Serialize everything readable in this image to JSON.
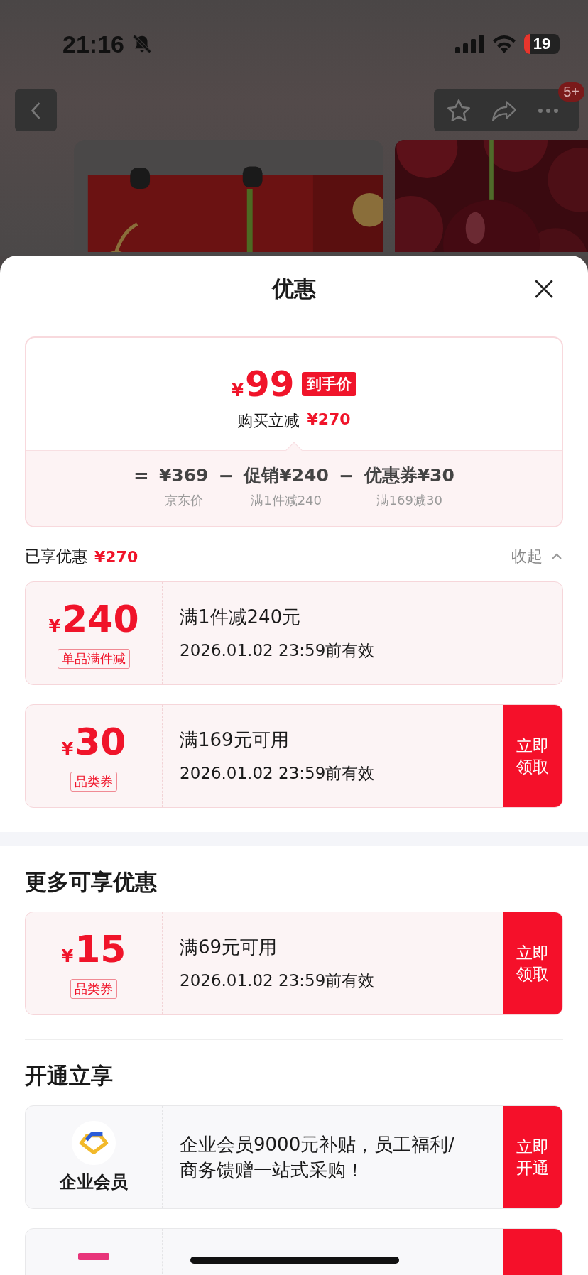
{
  "status_bar": {
    "time": "21:16",
    "battery": "19"
  },
  "nav": {
    "badge": "5+"
  },
  "sheet": {
    "title": "优惠",
    "summary": {
      "currency": "¥",
      "price": "99",
      "tag": "到手价",
      "saving_label": "购买立减",
      "saving": "¥270",
      "terms": [
        {
          "op": "=",
          "text": "¥369",
          "label": "京东价"
        },
        {
          "op": "−",
          "text": "促销¥240",
          "label": "满1件减240"
        },
        {
          "op": "−",
          "text": "优惠券¥30",
          "label": "满169减30"
        }
      ]
    },
    "enjoyed": {
      "label": "已享优惠",
      "amount": "¥270",
      "toggle": "收起",
      "expanded": true
    },
    "coupons": [
      {
        "kind": "promo",
        "currency": "¥",
        "amount": "240",
        "tag": "单品满件减",
        "title": "满1件减240元",
        "validity": "2026.01.02 23:59前有效"
      },
      {
        "kind": "coupon",
        "currency": "¥",
        "amount": "30",
        "tag": "品类券",
        "title": "满169元可用",
        "validity": "2026.01.02 23:59前有效",
        "button": "立即领取"
      }
    ],
    "more_title": "更多可享优惠",
    "more": [
      {
        "kind": "coupon",
        "currency": "¥",
        "amount": "15",
        "tag": "品类券",
        "title": "满69元可用",
        "validity": "2026.01.02 23:59前有效",
        "button": "立即领取"
      }
    ],
    "join_title": "开通立享",
    "memberships": [
      {
        "kind": "full",
        "name": "企业会员",
        "text": "企业会员9000元补贴，员工福利/商务馈赠一站式采购！",
        "button": "立即开通"
      },
      {
        "kind": "cut"
      }
    ]
  }
}
